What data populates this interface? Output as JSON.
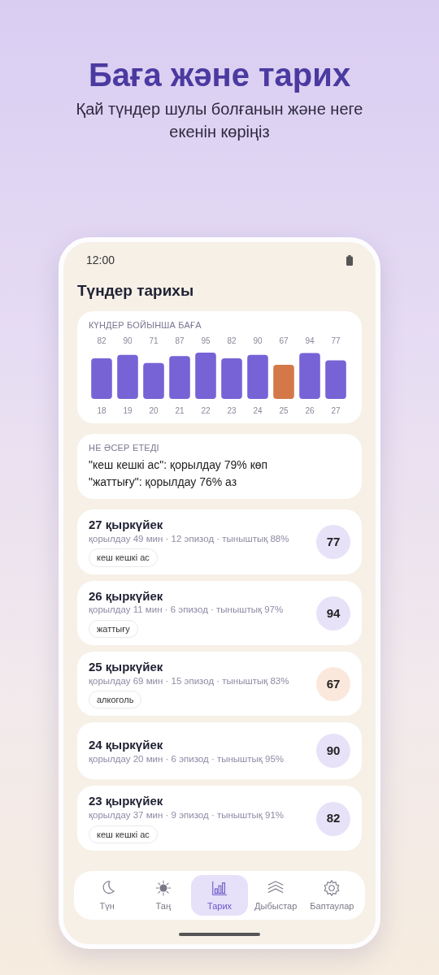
{
  "hero": {
    "title": "Баға және тарих",
    "subtitle": "Қай түндер шулы болғанын және неге екенін көріңіз"
  },
  "status_bar": {
    "time": "12:00"
  },
  "screen_title": "Түндер тарихы",
  "score_chart": {
    "chart_data": {
      "type": "bar",
      "title": "КҮНДЕР БОЙЫНША БАҒА",
      "categories": [
        "18",
        "19",
        "20",
        "21",
        "22",
        "23",
        "24",
        "25",
        "26",
        "27"
      ],
      "series": [
        {
          "color": "#7763d6",
          "values": [
            82,
            90,
            71,
            87,
            95,
            82,
            90,
            null,
            94,
            77
          ]
        },
        {
          "color": "#d4784a",
          "values": [
            null,
            null,
            null,
            null,
            null,
            null,
            null,
            67,
            null,
            null
          ]
        }
      ],
      "stacked": true,
      "data_labels": true
    }
  },
  "insights": {
    "title": "НЕ ӘСЕР ЕТЕДІ",
    "lines": [
      "\"кеш кешкі ас\": қорылдау 79% көп",
      "\"жаттығу\": қорылдау 76% аз"
    ]
  },
  "nights": [
    {
      "date": "27 қыркүйек",
      "stats": "қорылдау 49 мин · 12 эпизод · тыныштық 88%",
      "tag": "кеш кешкі ас",
      "score": "77",
      "low": false
    },
    {
      "date": "26 қыркүйек",
      "stats": "қорылдау 11 мин · 6 эпизод · тыныштық 97%",
      "tag": "жаттығу",
      "score": "94",
      "low": false
    },
    {
      "date": "25 қыркүйек",
      "stats": "қорылдау 69 мин · 15 эпизод · тыныштық 83%",
      "tag": "алкоголь",
      "score": "67",
      "low": true
    },
    {
      "date": "24 қыркүйек",
      "stats": "қорылдау 20 мин · 6 эпизод · тыныштық 95%",
      "score": "90",
      "low": false
    },
    {
      "date": "23 қыркүйек",
      "stats": "қорылдау 37 мин · 9 эпизод · тыныштық 91%",
      "tag": "кеш кешкі ас",
      "score": "82",
      "low": false
    }
  ],
  "nav": [
    {
      "label": "Түн",
      "selected": false
    },
    {
      "label": "Таң",
      "selected": false
    },
    {
      "label": "Тарих",
      "selected": true
    },
    {
      "label": "Дыбыстар",
      "selected": false
    },
    {
      "label": "Баптаулар",
      "selected": false
    }
  ]
}
